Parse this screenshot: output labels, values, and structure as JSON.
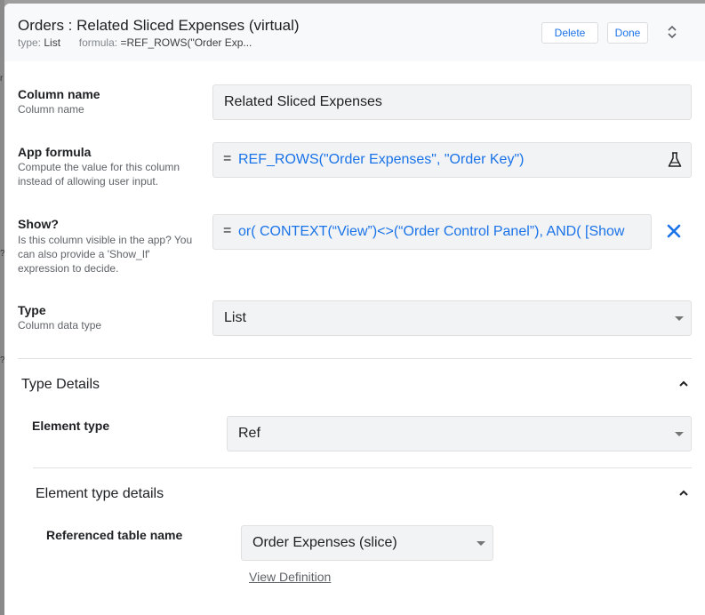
{
  "header": {
    "title": "Orders : Related Sliced Expenses (virtual)",
    "type_label": "type:",
    "type_value": "List",
    "formula_label": "formula:",
    "formula_value": "=REF_ROWS(\"Order Exp...",
    "delete_label": "Delete",
    "done_label": "Done"
  },
  "background": {
    "marks": [
      "r",
      "?",
      "?"
    ]
  },
  "fields": {
    "column_name": {
      "label": "Column name",
      "help": "Column name",
      "value": "Related Sliced Expenses"
    },
    "app_formula": {
      "label": "App formula",
      "help": "Compute the value for this column instead of allowing user input.",
      "eq": "=",
      "value": "REF_ROWS(\"Order Expenses\", \"Order Key\")"
    },
    "show": {
      "label": "Show?",
      "help": "Is this column visible in the app? You can also provide a 'Show_If' expression to decide.",
      "eq": "=",
      "value": "or(  CONTEXT(“View”)<>(“Order Control Panel”),  AND(  [Show"
    },
    "type": {
      "label": "Type",
      "help": "Column data type",
      "value": "List"
    }
  },
  "type_details": {
    "title": "Type Details",
    "element_type": {
      "label": "Element type",
      "value": "Ref"
    },
    "element_type_details": {
      "title": "Element type details",
      "referenced_table": {
        "label": "Referenced table name",
        "value": "Order Expenses (slice)"
      },
      "view_definition_label": "View Definition"
    }
  },
  "colors": {
    "accent": "#1a73e8",
    "field_bg": "#f1f3f4",
    "header_bg": "#f8f9fa"
  },
  "icons": {
    "flask": "flask-icon",
    "clear": "close-icon",
    "expand": "unfold-icon",
    "collapse": "chevron-up-icon"
  }
}
